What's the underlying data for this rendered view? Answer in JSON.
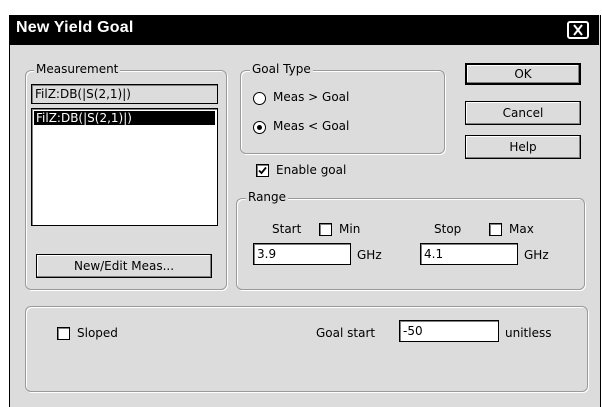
{
  "window": {
    "title": "New Yield Goal"
  },
  "measurement": {
    "legend": "Measurement",
    "current": "FilZ:DB(|S(2,1)|)",
    "items": [
      "FilZ:DB(|S(2,1)|)"
    ],
    "new_edit_label": "New/Edit Meas..."
  },
  "goal_type": {
    "legend": "Goal Type",
    "option1": "Meas > Goal",
    "option2": "Meas < Goal",
    "selected": "Meas < Goal"
  },
  "buttons": {
    "ok": "OK",
    "cancel": "Cancel",
    "help": "Help"
  },
  "enable_goal": {
    "label": "Enable goal",
    "checked": true
  },
  "range": {
    "legend": "Range",
    "start_label": "Start",
    "min_label": "Min",
    "min_checked": false,
    "start_value": "3.9",
    "start_unit": "GHz",
    "stop_label": "Stop",
    "max_label": "Max",
    "max_checked": false,
    "stop_value": "4.1",
    "stop_unit": "GHz"
  },
  "bottom": {
    "sloped_label": "Sloped",
    "sloped_checked": false,
    "goal_start_label": "Goal start",
    "goal_start_value": "-50",
    "goal_start_unit": "unitless"
  }
}
